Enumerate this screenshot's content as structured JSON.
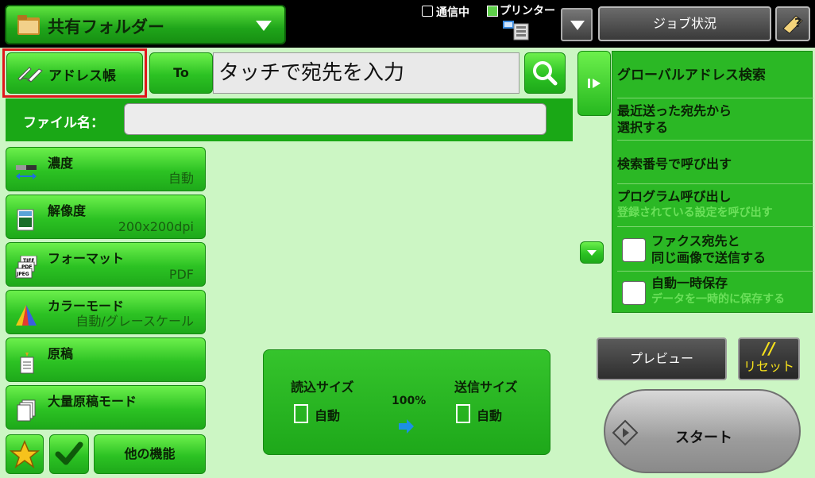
{
  "header": {
    "mode_label": "共有フォルダー",
    "comm_status": "通信中",
    "printer_status": "プリンター",
    "job_status_label": "ジョブ状況"
  },
  "address": {
    "book_label": "アドレス帳",
    "to_label": "To",
    "destination_placeholder": "タッチで宛先を入力"
  },
  "file": {
    "name_label": "ファイル名："
  },
  "functions": [
    {
      "name": "濃度",
      "value": "自動"
    },
    {
      "name": "解像度",
      "value": "200x200dpi"
    },
    {
      "name": "フォーマット",
      "value": "PDF"
    },
    {
      "name": "カラーモード",
      "value": "自動/グレースケール"
    },
    {
      "name": "原稿",
      "value": ""
    },
    {
      "name": "大量原稿モード",
      "value": ""
    }
  ],
  "format_icon_text": [
    "TIFF",
    "PDF",
    "JPEG"
  ],
  "other_functions_label": "他の機能",
  "size_panel": {
    "scan_size_label": "読込サイズ",
    "scan_size_value": "自動",
    "ratio": "100%",
    "send_size_label": "送信サイズ",
    "send_size_value": "自動"
  },
  "right_panel": {
    "global_search": "グローバルアドレス検索",
    "recent_line1": "最近送った宛先から",
    "recent_line2": "選択する",
    "search_number": "検索番号で呼び出す",
    "program_call": "プログラム呼び出し",
    "program_call_sub": "登録されている設定を呼び出す",
    "fax_same_line1": "ファクス宛先と",
    "fax_same_line2": "同じ画像で送信する",
    "auto_save": "自動一時保存",
    "auto_save_sub": "データを一時的に保存する"
  },
  "actions": {
    "preview_label": "プレビュー",
    "reset_mark": "//",
    "reset_label": "リセット",
    "start_label": "スタート"
  },
  "colors": {
    "accent_green": "#2cc223",
    "background": "#ccf6c4",
    "highlight_red": "#e0161b"
  }
}
